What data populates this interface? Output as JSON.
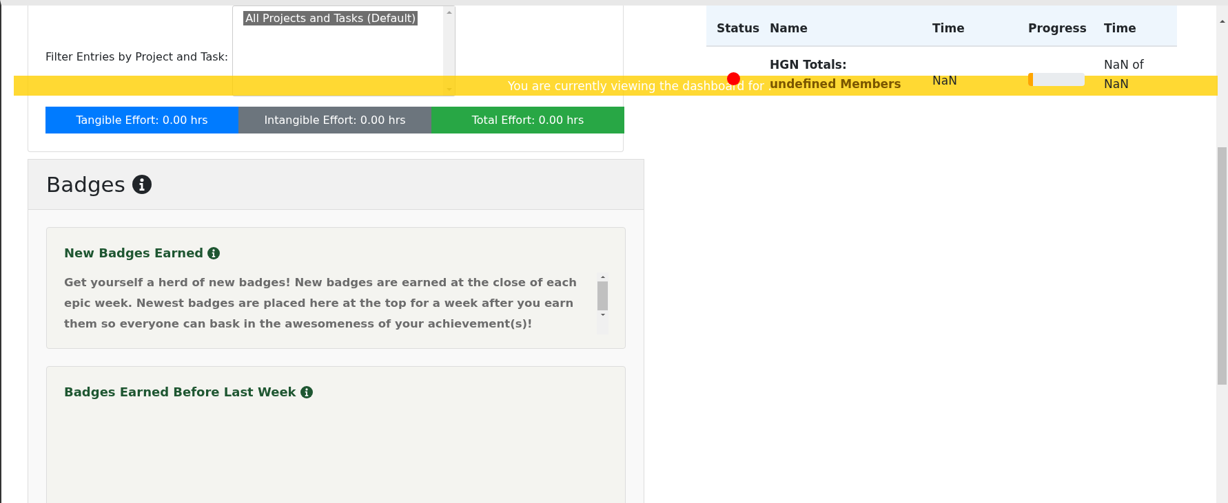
{
  "filter": {
    "label": "Filter Entries by Project and Task:",
    "options": [
      {
        "label": "All Projects and Tasks (Default)",
        "selected": true
      }
    ]
  },
  "efforts": [
    {
      "kind": "tangible",
      "label": "Tangible Effort: 0.00 hrs"
    },
    {
      "kind": "intangible",
      "label": "Intangible Effort: 0.00 hrs"
    },
    {
      "kind": "total",
      "label": "Total Effort: 0.00 hrs"
    }
  ],
  "badges": {
    "title": "Badges",
    "sections": [
      {
        "title": "New Badges Earned",
        "text": "Get yourself a herd of new badges! New badges are earned at the close of each epic week. Newest badges are placed here at the top for a week after you earn them so everyone can bask in the awesomeness of your achievement(s)!"
      },
      {
        "title": "Badges Earned Before Last Week"
      }
    ]
  },
  "table": {
    "columns": [
      "Status",
      "Name",
      "Time",
      "Progress",
      "Time"
    ],
    "rows": [
      {
        "color": "#ff0000",
        "name": "HGN Totals:",
        "members": "undefined Members",
        "tangible": "NaN",
        "level": 0.08,
        "total_1": "NaN of",
        "total_2": "NaN"
      }
    ]
  },
  "banner": {
    "text": "You are currently viewing the dashboard for ."
  }
}
